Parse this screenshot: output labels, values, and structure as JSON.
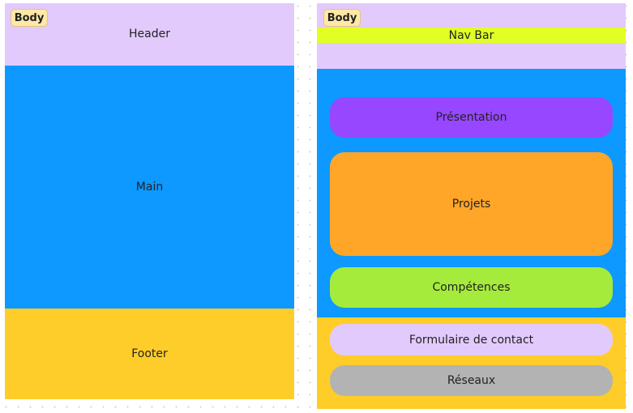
{
  "colors": {
    "header": "#e3cafc",
    "main": "#0d99ff",
    "footer": "#ffcd29",
    "navbar": "#e1ff25",
    "presentation": "#9747ff",
    "projets": "#ffa629",
    "competences": "#a5eb3b",
    "contact": "#e3cafc",
    "reseaux": "#b3b3b3",
    "badge": "#fde8a6"
  },
  "left": {
    "body_badge": "Body",
    "header": "Header",
    "main": "Main",
    "footer": "Footer"
  },
  "right": {
    "body_badge": "Body",
    "navbar": "Nav Bar",
    "sections": [
      "Présentation",
      "Projets",
      "Compétences"
    ],
    "footer_items": [
      "Formulaire de contact",
      "Réseaux"
    ]
  }
}
